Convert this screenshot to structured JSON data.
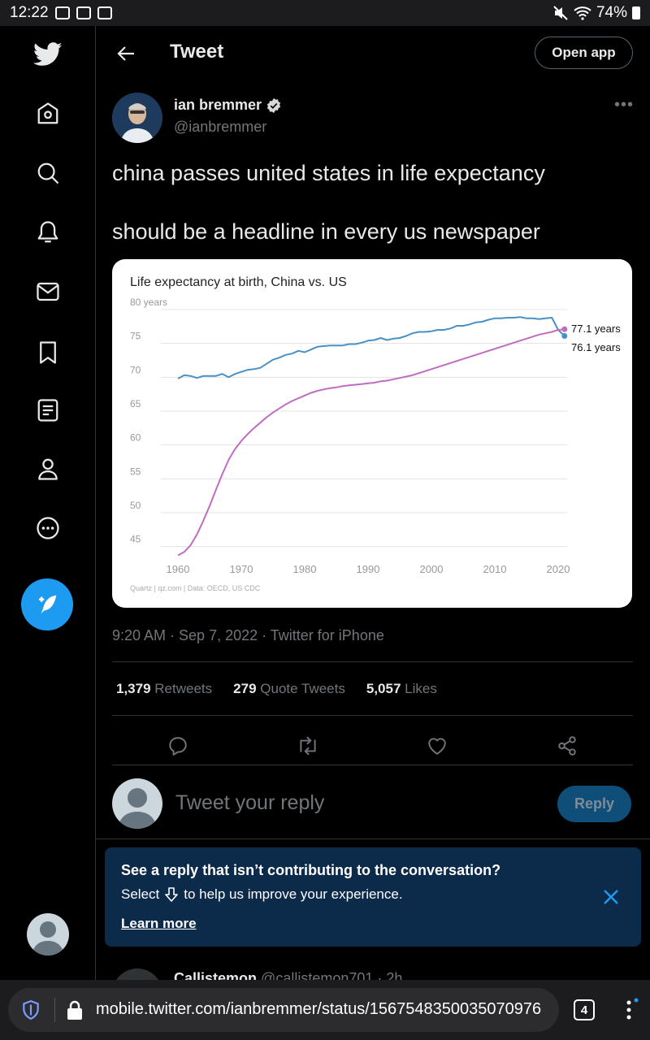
{
  "status_bar": {
    "time": "12:22",
    "battery": "74%"
  },
  "nav": {
    "items": [
      "Twitter",
      "Home",
      "Explore",
      "Notifications",
      "Messages",
      "Bookmarks",
      "Lists",
      "Profile",
      "More"
    ],
    "compose_label": "Tweet"
  },
  "header": {
    "title": "Tweet",
    "open_app": "Open app"
  },
  "tweet": {
    "author_name": "ian bremmer",
    "author_handle": "@ianbremmer",
    "text_line1": "china passes united states in life expectancy",
    "text_line2": "should be a headline in every us newspaper",
    "meta": "9:20 AM · Sep 7, 2022 · Twitter for iPhone",
    "stats": [
      {
        "count": "1,379",
        "label": "Retweets"
      },
      {
        "count": "279",
        "label": "Quote Tweets"
      },
      {
        "count": "5,057",
        "label": "Likes"
      }
    ]
  },
  "chart_data": {
    "type": "line",
    "title": "Life expectancy at birth, China vs. US",
    "ylabel": "",
    "y_top_label": "80 years",
    "yticks": [
      75,
      70,
      65,
      60,
      55,
      50,
      45
    ],
    "xticks": [
      1960,
      1970,
      1980,
      1990,
      2000,
      2010,
      2020
    ],
    "xlim": [
      1960,
      2020
    ],
    "ylim": [
      44,
      80
    ],
    "source": "Quartz | qz.com | Data: OECD, US CDC",
    "colors": {
      "us": "#4a90c4",
      "china": "#c06cc0"
    },
    "series": [
      {
        "key": "us",
        "end_label": "76.1 years",
        "points": [
          [
            1960,
            69.8
          ],
          [
            1961,
            70.3
          ],
          [
            1962,
            70.2
          ],
          [
            1963,
            69.9
          ],
          [
            1964,
            70.2
          ],
          [
            1965,
            70.2
          ],
          [
            1966,
            70.2
          ],
          [
            1967,
            70.5
          ],
          [
            1968,
            70.0
          ],
          [
            1969,
            70.5
          ],
          [
            1970,
            70.8
          ],
          [
            1971,
            71.1
          ],
          [
            1972,
            71.2
          ],
          [
            1973,
            71.4
          ],
          [
            1974,
            72.0
          ],
          [
            1975,
            72.6
          ],
          [
            1976,
            72.9
          ],
          [
            1977,
            73.3
          ],
          [
            1978,
            73.5
          ],
          [
            1979,
            73.9
          ],
          [
            1980,
            73.7
          ],
          [
            1981,
            74.1
          ],
          [
            1982,
            74.5
          ],
          [
            1983,
            74.6
          ],
          [
            1984,
            74.7
          ],
          [
            1985,
            74.7
          ],
          [
            1986,
            74.7
          ],
          [
            1987,
            74.9
          ],
          [
            1988,
            74.9
          ],
          [
            1989,
            75.1
          ],
          [
            1990,
            75.4
          ],
          [
            1991,
            75.5
          ],
          [
            1992,
            75.8
          ],
          [
            1993,
            75.5
          ],
          [
            1994,
            75.7
          ],
          [
            1995,
            75.8
          ],
          [
            1996,
            76.1
          ],
          [
            1997,
            76.5
          ],
          [
            1998,
            76.7
          ],
          [
            1999,
            76.7
          ],
          [
            2000,
            76.8
          ],
          [
            2001,
            77.0
          ],
          [
            2002,
            77.0
          ],
          [
            2003,
            77.2
          ],
          [
            2004,
            77.6
          ],
          [
            2005,
            77.6
          ],
          [
            2006,
            77.8
          ],
          [
            2007,
            78.1
          ],
          [
            2008,
            78.2
          ],
          [
            2009,
            78.5
          ],
          [
            2010,
            78.7
          ],
          [
            2011,
            78.7
          ],
          [
            2012,
            78.8
          ],
          [
            2013,
            78.8
          ],
          [
            2014,
            78.9
          ],
          [
            2015,
            78.7
          ],
          [
            2016,
            78.7
          ],
          [
            2017,
            78.6
          ],
          [
            2018,
            78.7
          ],
          [
            2019,
            78.8
          ],
          [
            2020,
            77.0
          ],
          [
            2021,
            76.1
          ]
        ]
      },
      {
        "key": "china",
        "end_label": "77.1 years",
        "points": [
          [
            1960,
            43.7
          ],
          [
            1961,
            44.2
          ],
          [
            1962,
            45.2
          ],
          [
            1963,
            46.8
          ],
          [
            1964,
            48.8
          ],
          [
            1965,
            51.0
          ],
          [
            1966,
            53.4
          ],
          [
            1967,
            55.7
          ],
          [
            1968,
            57.8
          ],
          [
            1969,
            59.4
          ],
          [
            1970,
            60.6
          ],
          [
            1971,
            61.6
          ],
          [
            1972,
            62.5
          ],
          [
            1973,
            63.3
          ],
          [
            1974,
            64.1
          ],
          [
            1975,
            64.8
          ],
          [
            1976,
            65.4
          ],
          [
            1977,
            66.0
          ],
          [
            1978,
            66.5
          ],
          [
            1979,
            66.9
          ],
          [
            1980,
            67.3
          ],
          [
            1981,
            67.7
          ],
          [
            1982,
            68.0
          ],
          [
            1983,
            68.2
          ],
          [
            1984,
            68.4
          ],
          [
            1985,
            68.5
          ],
          [
            1986,
            68.7
          ],
          [
            1987,
            68.8
          ],
          [
            1988,
            68.9
          ],
          [
            1989,
            69.0
          ],
          [
            1990,
            69.1
          ],
          [
            1991,
            69.2
          ],
          [
            1992,
            69.4
          ],
          [
            1993,
            69.5
          ],
          [
            1994,
            69.7
          ],
          [
            1995,
            69.9
          ],
          [
            1996,
            70.1
          ],
          [
            1997,
            70.3
          ],
          [
            1998,
            70.6
          ],
          [
            1999,
            70.9
          ],
          [
            2000,
            71.2
          ],
          [
            2001,
            71.5
          ],
          [
            2002,
            71.8
          ],
          [
            2003,
            72.1
          ],
          [
            2004,
            72.4
          ],
          [
            2005,
            72.7
          ],
          [
            2006,
            73.0
          ],
          [
            2007,
            73.3
          ],
          [
            2008,
            73.6
          ],
          [
            2009,
            73.9
          ],
          [
            2010,
            74.2
          ],
          [
            2011,
            74.5
          ],
          [
            2012,
            74.8
          ],
          [
            2013,
            75.1
          ],
          [
            2014,
            75.4
          ],
          [
            2015,
            75.7
          ],
          [
            2016,
            76.0
          ],
          [
            2017,
            76.3
          ],
          [
            2018,
            76.5
          ],
          [
            2019,
            76.7
          ],
          [
            2020,
            77.0
          ],
          [
            2021,
            77.1
          ]
        ]
      }
    ]
  },
  "reply": {
    "placeholder": "Tweet your reply",
    "button": "Reply"
  },
  "prompt": {
    "title": "See a reply that isn’t contributing to the conversation?",
    "body_before": "Select",
    "body_after": "to help us improve your experience.",
    "link": "Learn more"
  },
  "next_tweet": {
    "name": "Callistemon",
    "handle": "@callistemon701 · 2h"
  },
  "browser": {
    "url": "mobile.twitter.com/ianbremmer/status/1567548350035070976",
    "tab_count": "4"
  }
}
